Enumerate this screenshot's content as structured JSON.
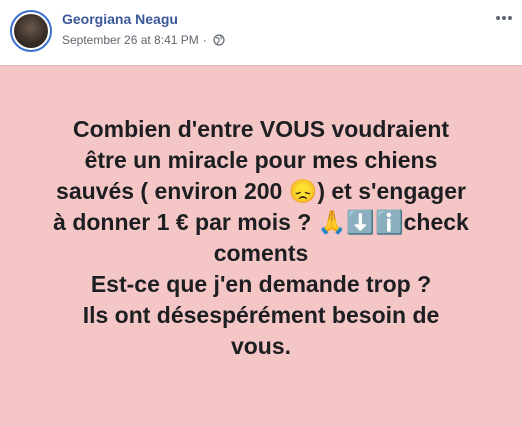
{
  "post": {
    "author": "Georgiana Neagu",
    "timestamp": "September 26 at 8:41 PM",
    "separator": "·",
    "privacy_icon": "globe-icon",
    "menu_icon": "more-horizontal-icon",
    "message": "Combien d'entre VOUS voudraient\nêtre un miracle pour mes chiens\nsauvés ( environ 200 😞) et s'engager\nà donner 1 € par mois ? 🙏⬇️ℹ️check\ncoments\nEst-ce que j'en demande trop ?\nIls ont désespérément besoin de\nvous.",
    "background_color": "#f5c6c6",
    "author_color": "#385898"
  }
}
